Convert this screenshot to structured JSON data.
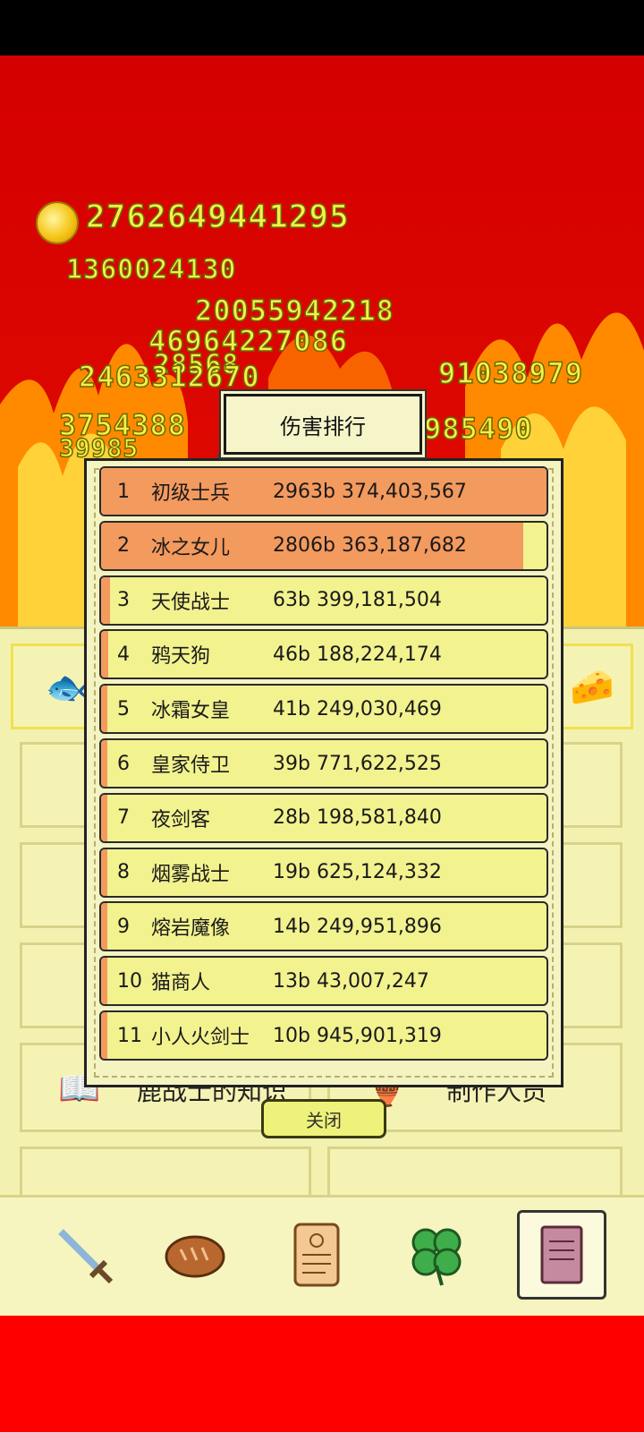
{
  "hud": {
    "gold_amount": "2762649441295"
  },
  "floating_damage": [
    "1360024130",
    "20055942218",
    "46964227086",
    "28568",
    "2463312670",
    "91038979",
    "3754388",
    "39985",
    "985490"
  ],
  "panel": {
    "row_left_label": "鹿战士的知识",
    "row_right_label": "制作人员"
  },
  "nav": [
    "sword-icon",
    "bread-icon",
    "scroll-icon",
    "clover-icon",
    "book-icon"
  ],
  "dialog": {
    "title": "伤害排行",
    "close_label": "关闭",
    "rows": [
      {
        "rank": "1",
        "name": "初级士兵",
        "damage": "2963b 374,403,567",
        "bar_fraction": 1.0
      },
      {
        "rank": "2",
        "name": "冰之女儿",
        "damage": "2806b 363,187,682",
        "bar_fraction": 0.947
      },
      {
        "rank": "3",
        "name": "天使战士",
        "damage": "63b 399,181,504",
        "bar_fraction": 0.021
      },
      {
        "rank": "4",
        "name": "鸦天狗",
        "damage": "46b 188,224,174",
        "bar_fraction": 0.016
      },
      {
        "rank": "5",
        "name": "冰霜女皇",
        "damage": "41b 249,030,469",
        "bar_fraction": 0.014
      },
      {
        "rank": "6",
        "name": "皇家侍卫",
        "damage": "39b 771,622,525",
        "bar_fraction": 0.013
      },
      {
        "rank": "7",
        "name": "夜剑客",
        "damage": "28b 198,581,840",
        "bar_fraction": 0.01
      },
      {
        "rank": "8",
        "name": "烟雾战士",
        "damage": "19b 625,124,332",
        "bar_fraction": 0.007
      },
      {
        "rank": "9",
        "name": "熔岩魔像",
        "damage": "14b 249,951,896",
        "bar_fraction": 0.005
      },
      {
        "rank": "10",
        "name": "猫商人",
        "damage": "13b 43,007,247",
        "bar_fraction": 0.004
      },
      {
        "rank": "11",
        "name": "小人火剑士",
        "damage": "10b 945,901,319",
        "bar_fraction": 0.003
      }
    ]
  },
  "colors": {
    "bar_fill": "#f39a5e",
    "row_bg": "#f2f28f",
    "gold_text": "#f4f04a"
  }
}
